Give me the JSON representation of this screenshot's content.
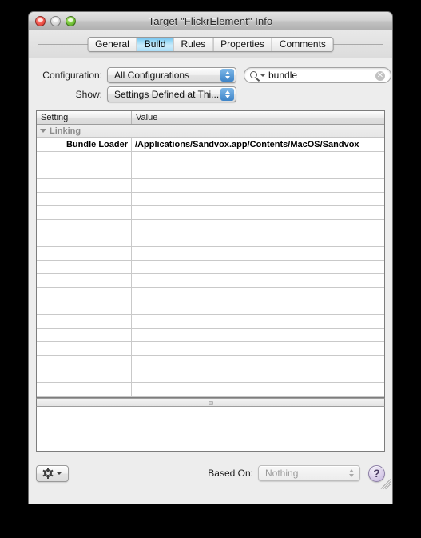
{
  "window": {
    "title": "Target \"FlickrElement\" Info",
    "traffic_lights": [
      "close",
      "minimize",
      "zoom"
    ]
  },
  "tabs": [
    {
      "label": "General",
      "selected": false
    },
    {
      "label": "Build",
      "selected": true
    },
    {
      "label": "Rules",
      "selected": false
    },
    {
      "label": "Properties",
      "selected": false
    },
    {
      "label": "Comments",
      "selected": false
    }
  ],
  "config": {
    "configuration_label": "Configuration:",
    "configuration_value": "All Configurations",
    "show_label": "Show:",
    "show_value": "Settings Defined at Thi...",
    "search_value": "bundle",
    "search_placeholder": "Search"
  },
  "table": {
    "columns": [
      "Setting",
      "Value"
    ],
    "groups": [
      {
        "name": "Linking",
        "expanded": true,
        "rows": [
          {
            "setting": "Bundle Loader",
            "value": "/Applications/Sandvox.app/Contents/MacOS/Sandvox"
          }
        ]
      }
    ],
    "empty_row_count": 19
  },
  "bottom": {
    "action_label": "Action",
    "based_on_label": "Based On:",
    "based_on_value": "Nothing",
    "based_on_enabled": false,
    "help_label": "?"
  }
}
